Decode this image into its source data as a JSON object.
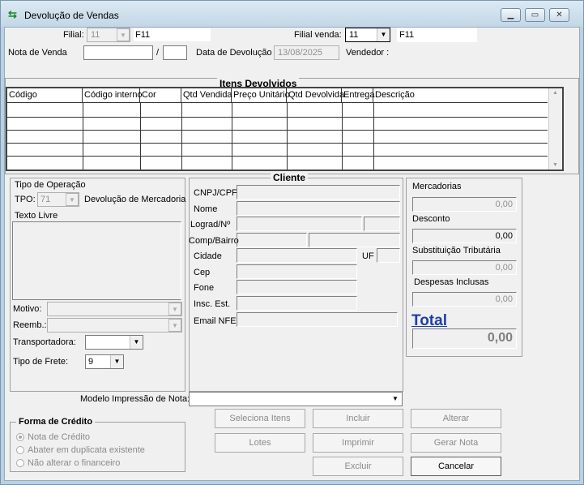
{
  "window": {
    "title": "Devolução de Vendas",
    "icon": "transfer-arrows-icon"
  },
  "header": {
    "filial_label": "Filial:",
    "filial_value": "11",
    "filial_name": "F11",
    "filial_venda_label": "Filial venda:",
    "filial_venda_value": "11",
    "filial_venda_name": "F11",
    "nota_venda_label": "Nota de Venda",
    "nota_venda_value": "",
    "slash": "/",
    "serie_value": "",
    "data_devolucao_label": "Data de Devolução",
    "data_devolucao_value": "13/08/2025",
    "vendedor_label": "Vendedor :"
  },
  "itens": {
    "title": "Itens Devolvidos",
    "columns": [
      "Código",
      "Código interno",
      "Cor",
      "Qtd Vendida",
      "Preço Unitário",
      "Qtd Devolvida",
      "Entrega",
      "Descrição"
    ],
    "rows": []
  },
  "operacao": {
    "title": "Tipo de Operação",
    "tpo_label": "TPO:",
    "tpo_value": "71",
    "tpo_desc": "Devolução de Mercadoria",
    "texto_livre_label": "Texto Livre",
    "motivo_label": "Motivo:",
    "reemb_label": "Reemb.:",
    "transportadora_label": "Transportadora:",
    "tipo_frete_label": "Tipo de Frete:",
    "tipo_frete_value": "9"
  },
  "cliente": {
    "title": "Cliente",
    "labels": [
      "CNPJ/CPF",
      "Nome",
      "Lograd/Nº",
      "Comp/Bairro",
      "Cidade",
      "UF",
      "Cep",
      "Fone",
      "Insc. Est.",
      "Email NFE"
    ]
  },
  "totais": {
    "mercadorias_label": "Mercadorias",
    "mercadorias_value": "0,00",
    "desconto_label": "Desconto",
    "desconto_value": "0,00",
    "st_label": "Substituição Tributária",
    "st_value": "0,00",
    "despesas_label": "Despesas Inclusas",
    "despesas_value": "0,00",
    "total_label": "Total",
    "total_value": "0,00"
  },
  "modelo": {
    "label": "Modelo Impressão de Nota:",
    "value": ""
  },
  "credito": {
    "title": "Forma de Crédito",
    "options": [
      "Nota de Crédito",
      "Abater em duplicata existente",
      "Não alterar o financeiro"
    ]
  },
  "buttons": {
    "seleciona": "Seleciona Itens",
    "incluir": "Incluir",
    "alterar": "Alterar",
    "lotes": "Lotes",
    "imprimir": "Imprimir",
    "gerar_nota": "Gerar Nota",
    "excluir": "Excluir",
    "cancelar": "Cancelar"
  }
}
